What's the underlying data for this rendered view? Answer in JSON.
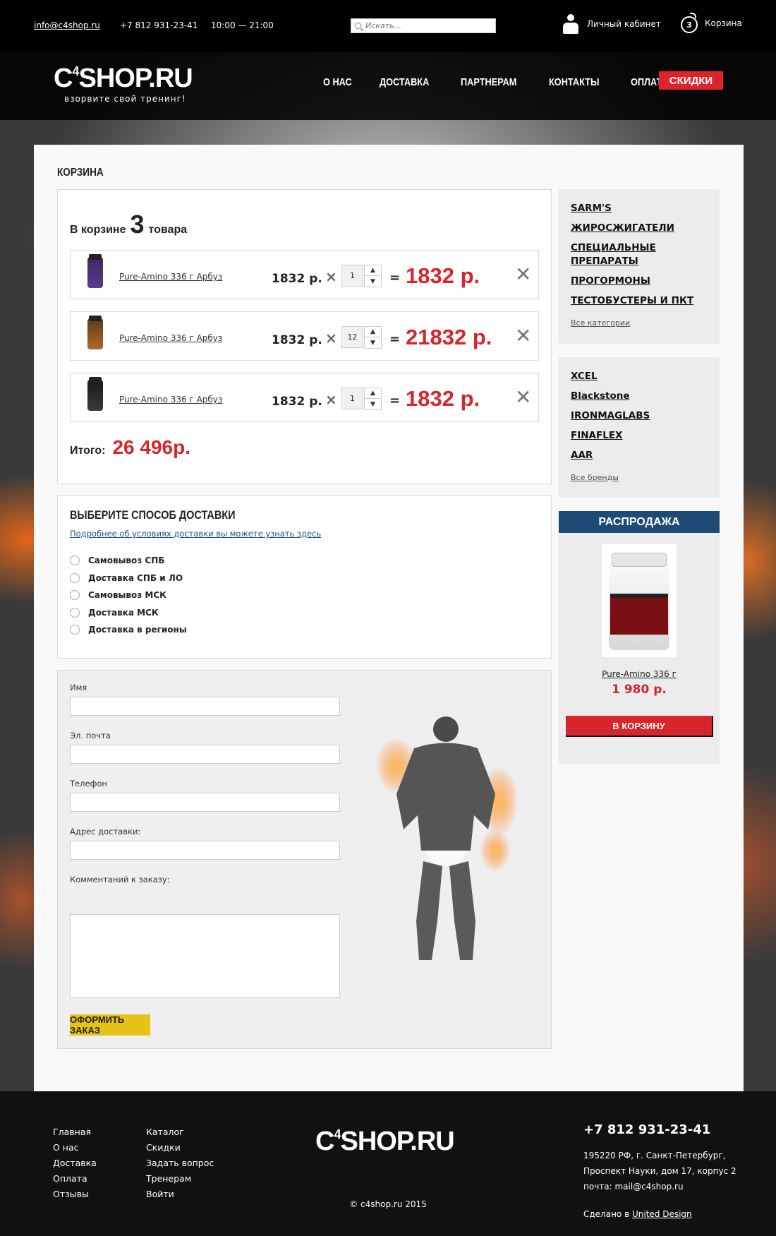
{
  "topbar": {
    "email": "info@c4shop.ru",
    "phone": "+7 812 931-23-41",
    "hours": "10:00 — 21:00",
    "search_placeholder": "Искать...",
    "account_label": "Личный кабинет",
    "cart_count": "3",
    "cart_label": "Корзина"
  },
  "header": {
    "logo_text": "C",
    "logo_sup": "4",
    "logo_rest": "SHOP.RU",
    "tagline": "взорвите свой тренинг!",
    "nav": [
      "О НАС",
      "ДОСТАВКА",
      "ПАРТНЕРАМ",
      "КОНТАКТЫ",
      "ОПЛАТА"
    ],
    "sale_button": "СКИДКИ"
  },
  "page": {
    "title": "КОРЗИНА"
  },
  "cart": {
    "head_prefix": "В корзине",
    "count": "3",
    "head_suffix": "товара",
    "items": [
      {
        "name": "Pure-Amino 336 г Арбуз",
        "price": "1832 р.",
        "qty": "1",
        "total": "1832 р."
      },
      {
        "name": "Pure-Amino 336 г Арбуз",
        "price": "1832 р.",
        "qty": "12",
        "total": "21832 р."
      },
      {
        "name": "Pure-Amino 336 г Арбуз",
        "price": "1832 р.",
        "qty": "1",
        "total": "1832 р."
      }
    ],
    "sum_label": "Итого:",
    "sum_value": "26 496р."
  },
  "shipping": {
    "title": "ВЫБЕРИТЕ СПОСОБ ДОСТАВКИ",
    "link": "Подробнее об условиях доставки вы можете узнать здесь",
    "options": [
      "Самовывоз СПБ",
      "Доставка СПБ и ЛО",
      "Самовывоз МСК",
      "Доставка МСК",
      "Доставка в регионы"
    ]
  },
  "form": {
    "name_label": "Имя",
    "email_label": "Эл. почта",
    "phone_label": "Телефон",
    "address_label": "Адрес доставки:",
    "comment_label": "Комментаний к заказу:",
    "submit": "ОФОРМИТЬ ЗАКАЗ"
  },
  "sidebar": {
    "categories": [
      "SARM'S",
      "ЖИРОСЖИГАТЕЛИ",
      "СПЕЦИАЛЬНЫЕ ПРЕПАРАТЫ",
      "ПРОГОРМОНЫ",
      "ТЕСТОБУСТЕРЫ И ПКТ"
    ],
    "all_categories": "Все категории",
    "brands": [
      "XCEL",
      "Blackstone",
      "IRONMAGLABS",
      "FINAFLEX",
      "AAR"
    ],
    "all_brands": "Все бренды",
    "sale_title": "РАСПРОДАЖА",
    "sale_product": "Pure-Amino 336 г",
    "sale_price": "1 980 р.",
    "sale_button": "В КОРЗИНУ"
  },
  "footer": {
    "col1": [
      "Главная",
      "О нас",
      "Доставка",
      "Оплата",
      "Отзывы"
    ],
    "col2": [
      "Каталог",
      "Скидки",
      "Задать вопрос",
      "Тренерам",
      "Войти"
    ],
    "copyright": "© c4shop.ru 2015",
    "phone": "+7 812 931-23-41",
    "address_line1": "195220 РФ, г. Санкт-Петербург,",
    "address_line2": "Проспект Науки, дом 17, корпус 2",
    "address_line3": "почта: mail@c4shop.ru",
    "made_prefix": "Сделано в",
    "made_link": "United Design"
  },
  "colors": {
    "accent_red": "#d7262b",
    "sale_blue": "#1e4b75",
    "submit_yellow": "#e6c318"
  }
}
